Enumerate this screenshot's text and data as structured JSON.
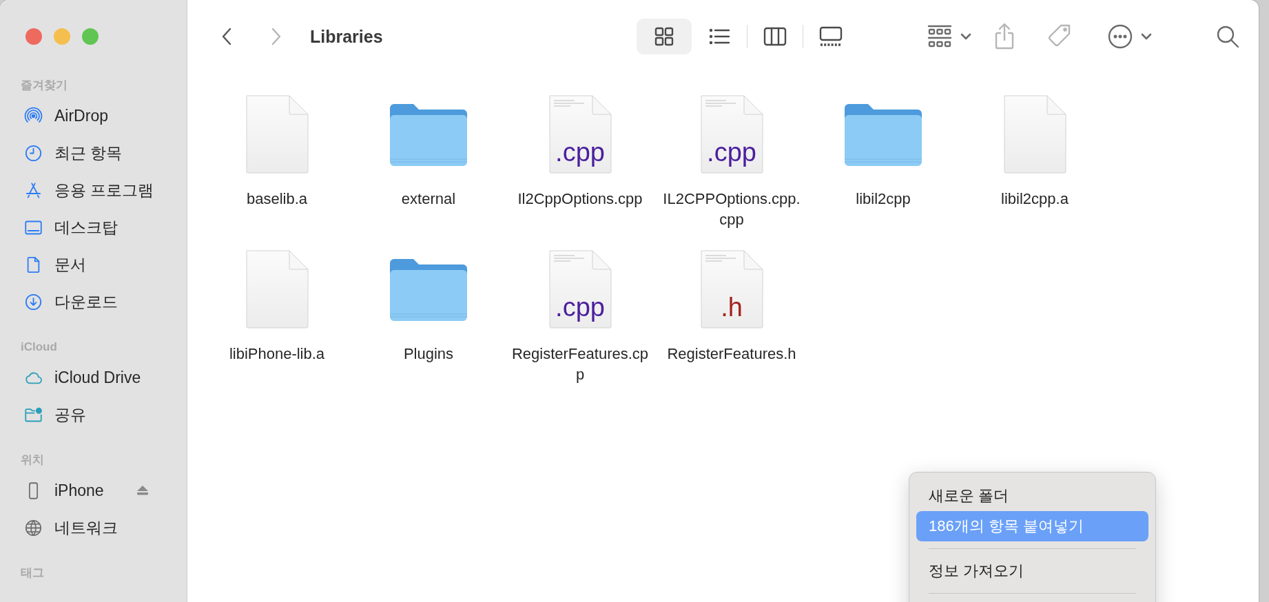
{
  "window": {
    "title": "Libraries"
  },
  "navigation": [
    {
      "kind": "back",
      "disabled": false
    },
    {
      "kind": "forward",
      "disabled": true
    }
  ],
  "view_modes": [
    {
      "kind": "icons",
      "selected": true
    },
    {
      "kind": "list",
      "selected": false
    },
    {
      "kind": "columns",
      "selected": false
    },
    {
      "kind": "gallery",
      "selected": false
    }
  ],
  "actions": [
    {
      "kind": "group",
      "disabled": false
    },
    {
      "kind": "share",
      "disabled": true
    },
    {
      "kind": "tags",
      "disabled": true
    },
    {
      "kind": "more",
      "disabled": false
    },
    {
      "kind": "search",
      "disabled": false
    }
  ],
  "sidebar": {
    "sections": [
      {
        "heading": "즐겨찾기",
        "items": [
          {
            "label": "AirDrop",
            "kind": "airdrop"
          },
          {
            "label": "최근 항목",
            "kind": "recents"
          },
          {
            "label": "응용 프로그램",
            "kind": "applications"
          },
          {
            "label": "데스크탑",
            "kind": "desktop"
          },
          {
            "label": "문서",
            "kind": "documents"
          },
          {
            "label": "다운로드",
            "kind": "downloads"
          }
        ]
      },
      {
        "heading": "iCloud",
        "items": [
          {
            "label": "iCloud Drive",
            "kind": "cloud"
          },
          {
            "label": "공유",
            "kind": "shared"
          }
        ]
      },
      {
        "heading": "위치",
        "items": [
          {
            "label": "iPhone",
            "kind": "phone",
            "ejectable": true
          },
          {
            "label": "네트워크",
            "kind": "network",
            "ejectable": false
          }
        ]
      },
      {
        "heading": "태그"
      }
    ]
  },
  "files": [
    {
      "name": "baselib.a",
      "kind": "document"
    },
    {
      "name": "external",
      "kind": "folder"
    },
    {
      "name": "Il2CppOptions.cpp",
      "kind": "source",
      "badge": ".cpp"
    },
    {
      "name": "IL2CPPOptions.cpp.cpp",
      "kind": "source",
      "badge": ".cpp"
    },
    {
      "name": "libil2cpp",
      "kind": "folder"
    },
    {
      "name": "libil2cpp.a",
      "kind": "document"
    },
    {
      "name": "libiPhone-lib.a",
      "kind": "document"
    },
    {
      "name": "Plugins",
      "kind": "folder"
    },
    {
      "name": "RegisterFeatures.cpp",
      "kind": "source",
      "badge": ".cpp"
    },
    {
      "name": "RegisterFeatures.h",
      "kind": "header",
      "badge": ".h"
    }
  ],
  "context_menu": {
    "items": [
      {
        "kind": "item",
        "label": "새로운 폴더",
        "selected": false
      },
      {
        "kind": "item",
        "label": "186개의 항목 붙여넣기",
        "selected": true
      },
      {
        "kind": "separator"
      },
      {
        "kind": "item",
        "label": "정보 가져오기",
        "selected": false
      },
      {
        "kind": "separator"
      }
    ]
  }
}
